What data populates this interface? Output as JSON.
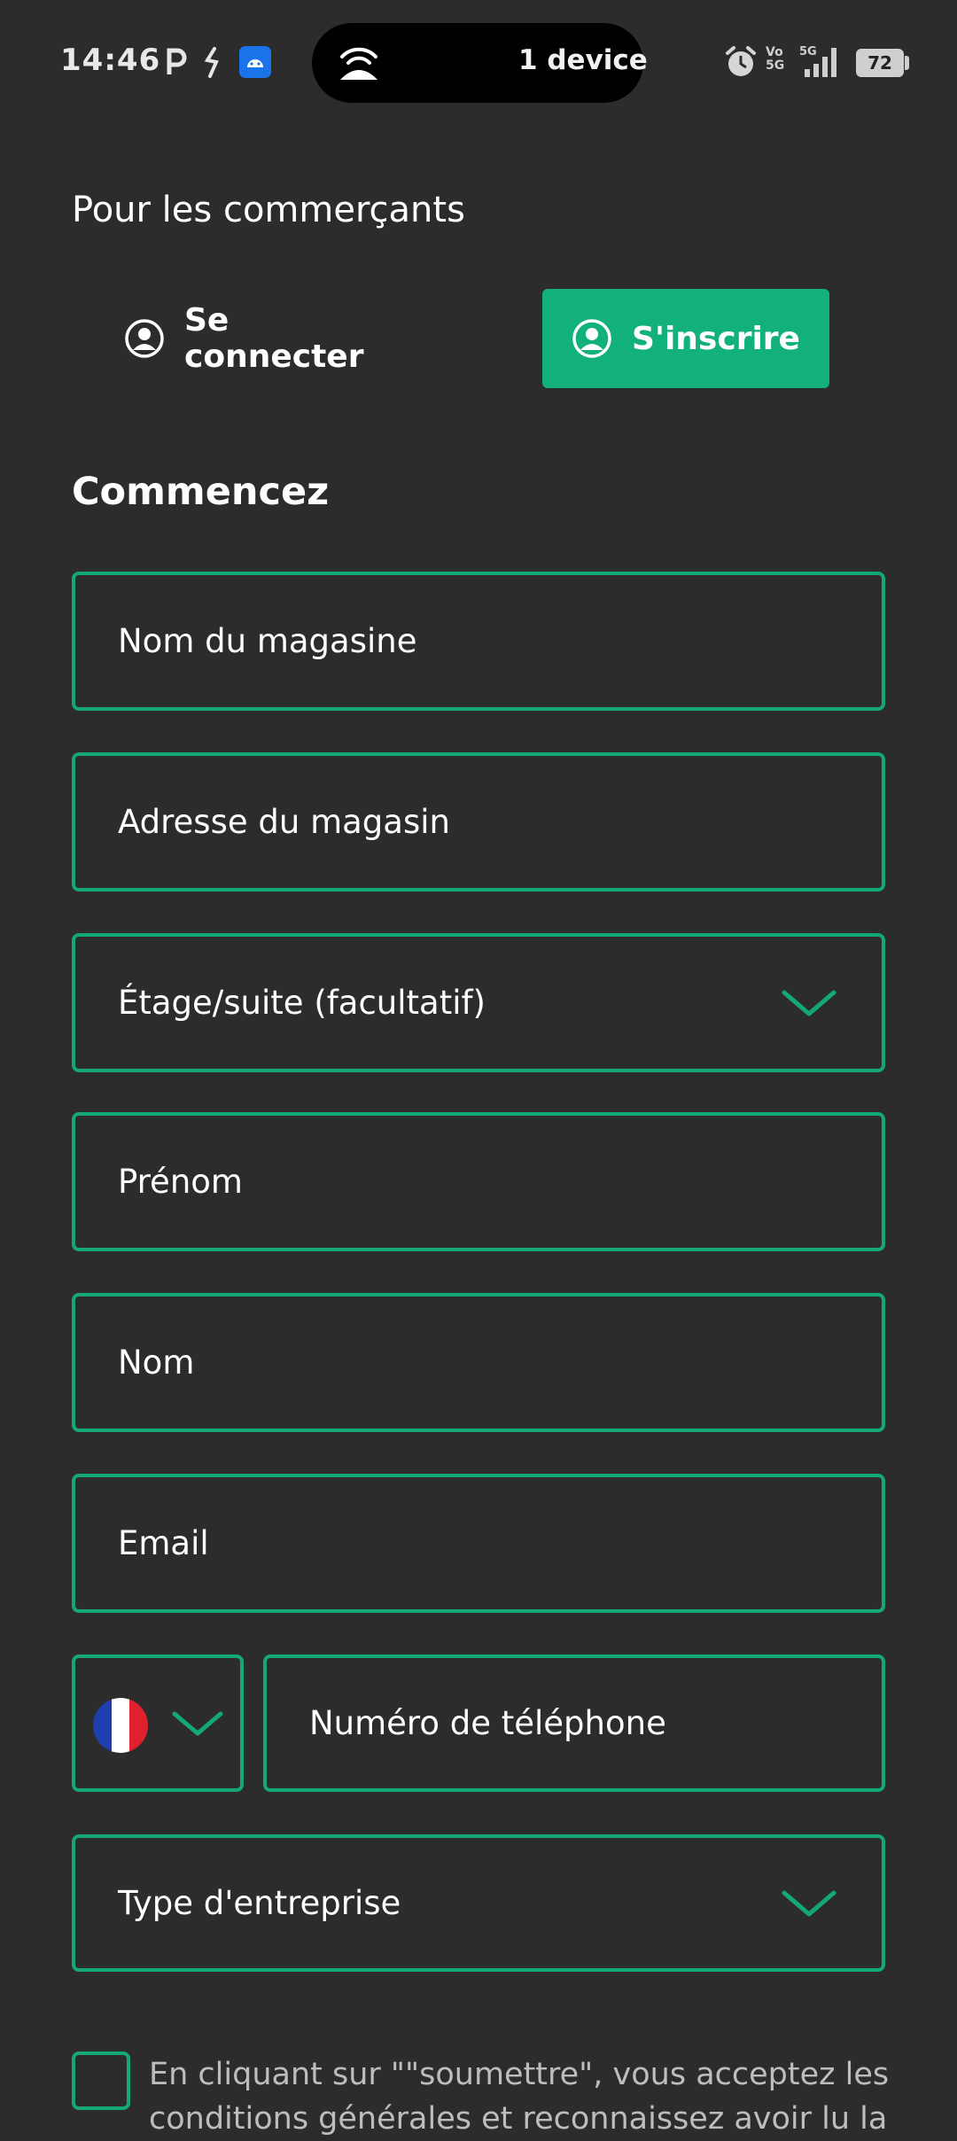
{
  "status_bar": {
    "time": "14:46",
    "island_label": "1 device",
    "battery": "72"
  },
  "page": {
    "section_title": "Pour les commerçants",
    "tabs": [
      {
        "label": "Se connecter",
        "active": false
      },
      {
        "label": "S'inscrire",
        "active": true
      }
    ],
    "heading": "Commencez"
  },
  "form": {
    "store_name": {
      "placeholder": "Nom du magasine"
    },
    "store_address": {
      "placeholder": "Adresse du magasin"
    },
    "floor_suite": {
      "placeholder": "Étage/suite (facultatif)",
      "icon": "chevron-down-icon"
    },
    "first_name": {
      "placeholder": "Prénom"
    },
    "last_name": {
      "placeholder": "Nom"
    },
    "email": {
      "placeholder": "Email"
    },
    "country_code": {
      "flag": "france-flag-icon",
      "icon": "chevron-down-icon"
    },
    "phone": {
      "placeholder": "Numéro de téléphone"
    },
    "business_type": {
      "placeholder": "Type d'entreprise",
      "icon": "chevron-down-icon"
    },
    "terms_text": "En cliquant sur \"\"soumettre\", vous acceptez les conditions générales et reconnaissez avoir lu la"
  },
  "colors": {
    "background": "#2c2c2c",
    "accent": "#12b07a",
    "field_border": "#14a873"
  }
}
